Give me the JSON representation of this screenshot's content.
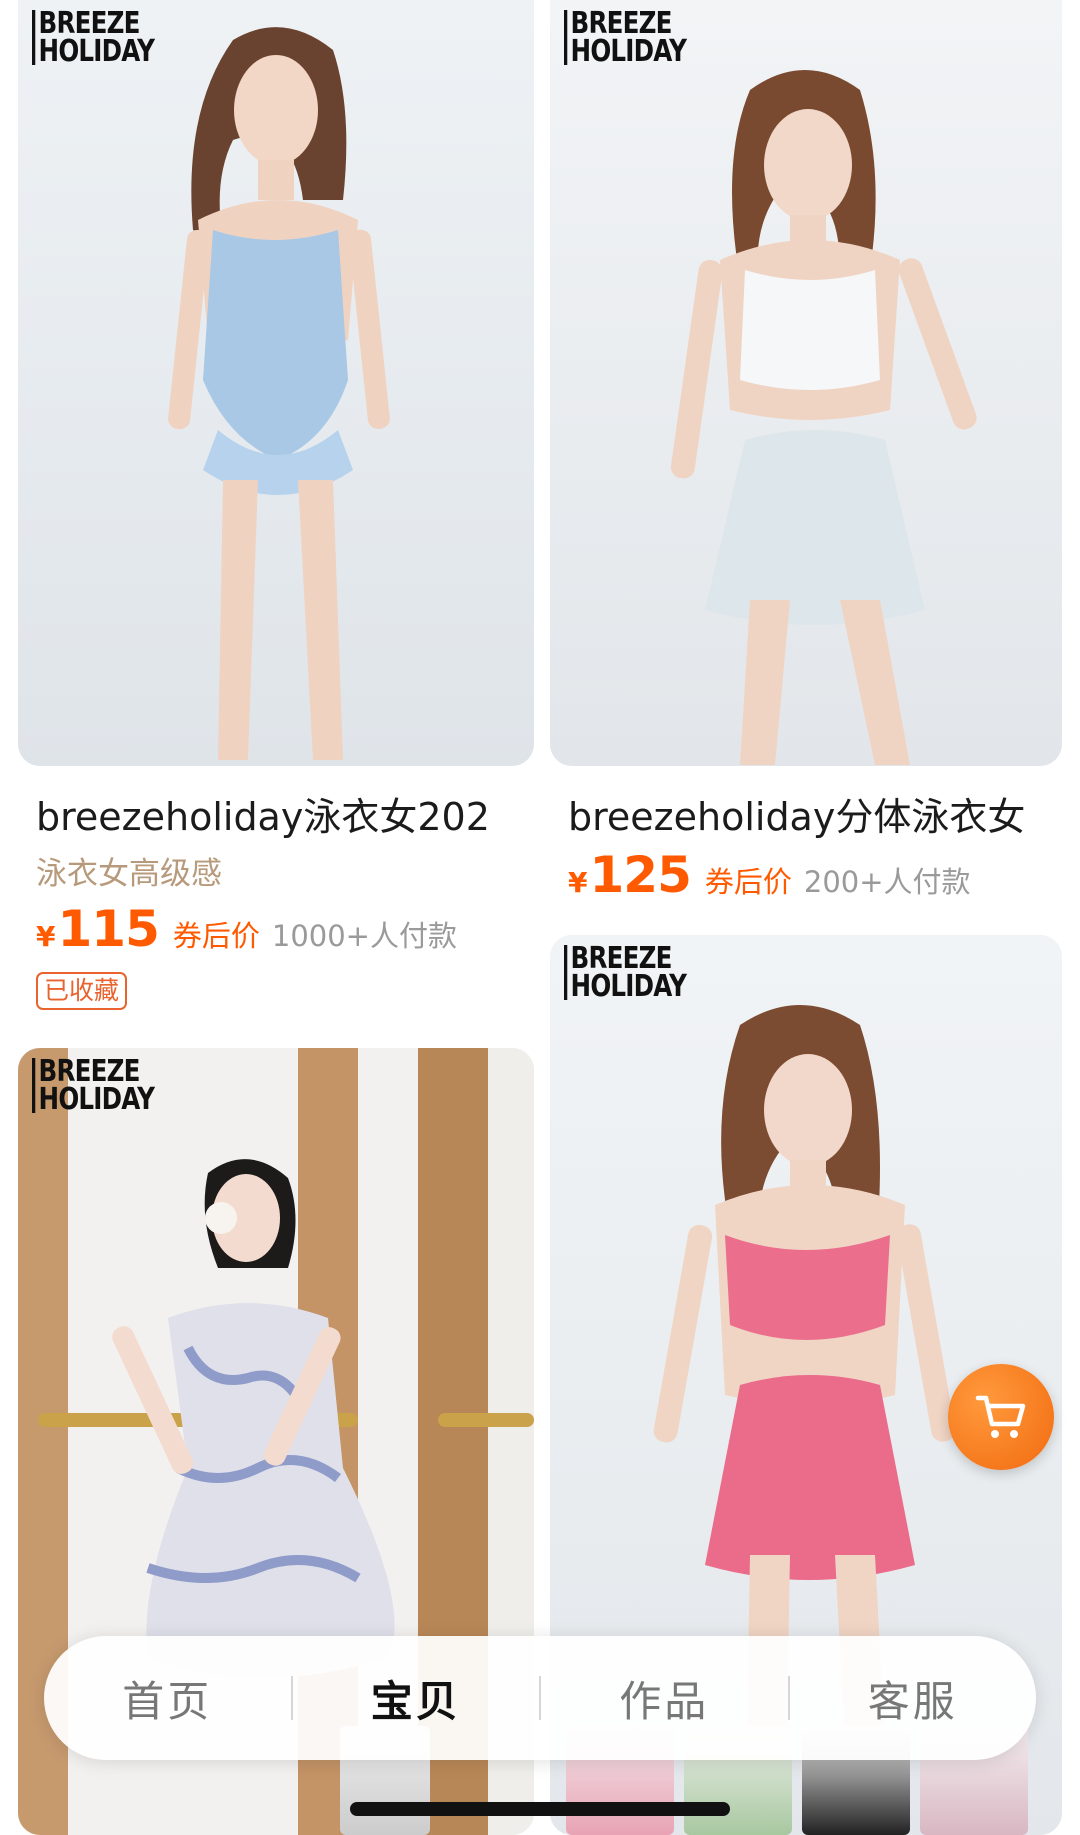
{
  "brand_logo": {
    "line1": "BREEZE",
    "line2": "HOLIDAY"
  },
  "products": [
    {
      "title": "breezeholiday泳衣女202",
      "subtitle": "泳衣女高级感",
      "currency": "¥",
      "price": "115",
      "coupon_label": "券后价",
      "sales": "1000+人付款",
      "badge": "已收藏",
      "image": "model-blue-onepiece-swimsuit"
    },
    {
      "title": "breezeholiday分体泳衣女",
      "currency": "¥",
      "price": "125",
      "coupon_label": "券后价",
      "sales": "200+人付款",
      "image": "model-white-top-skirt-swimsuit"
    },
    {
      "image": "model-floral-dress-swimsuit"
    },
    {
      "image": "model-pink-halter-skirt-swimsuit"
    }
  ],
  "cart_button": {
    "icon": "cart-icon",
    "color": "#f47a1f"
  },
  "tabbar": {
    "tabs": [
      {
        "label": "首页",
        "active": false
      },
      {
        "label": "宝贝",
        "active": true
      },
      {
        "label": "作品",
        "active": false
      },
      {
        "label": "客服",
        "active": false
      }
    ]
  },
  "colors": {
    "accent": "#ff5a00",
    "subtitle": "#b79a7c",
    "muted": "#9a9a9a"
  }
}
